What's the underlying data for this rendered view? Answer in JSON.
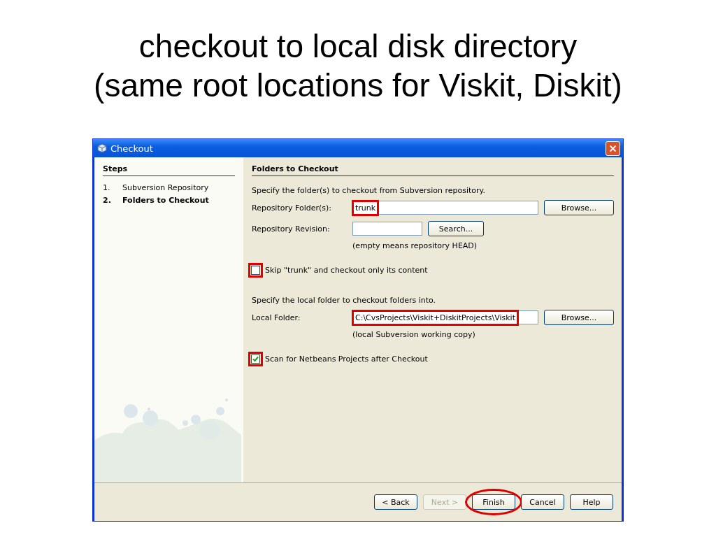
{
  "slide_title": [
    "checkout to local disk directory",
    "(same root locations for Viskit, Diskit)"
  ],
  "window": {
    "title": "Checkout"
  },
  "steps": {
    "heading": "Steps",
    "items": [
      {
        "number": "1.",
        "label": "Subversion Repository",
        "selected": false
      },
      {
        "number": "2.",
        "label": "Folders to Checkout",
        "selected": true
      }
    ]
  },
  "panel": {
    "heading": "Folders to Checkout",
    "rows": [
      {
        "kind": "text",
        "text": "Specify the folder(s) to checkout from Subversion repository."
      },
      {
        "kind": "field",
        "label": "Repository Folder(s):",
        "value": "trunk",
        "wide": true,
        "boxed": true,
        "button": "Browse..."
      },
      {
        "kind": "field",
        "label": "Repository Revision:",
        "value": "",
        "wide": false,
        "boxed": false,
        "button": "Search..."
      },
      {
        "kind": "hint",
        "text": "(empty means repository HEAD)"
      },
      {
        "kind": "checkbox",
        "label": "Skip \"trunk\" and checkout only its content",
        "checked": false,
        "boxed": true
      },
      {
        "kind": "text",
        "text": "Specify the local folder to checkout folders into."
      },
      {
        "kind": "field",
        "label": "Local Folder:",
        "value": "C:\\CvsProjects\\Viskit+DiskitProjects\\Viskit",
        "wide": true,
        "boxed": true,
        "button": "Browse..."
      },
      {
        "kind": "hint",
        "text": "(local Subversion working copy)"
      },
      {
        "kind": "checkbox",
        "label": "Scan for Netbeans Projects after Checkout",
        "checked": true,
        "boxed": true
      }
    ]
  },
  "buttons": [
    {
      "label": "< Back",
      "disabled": false,
      "circled": false
    },
    {
      "label": "Next >",
      "disabled": true,
      "circled": false
    },
    {
      "label": "Finish",
      "disabled": false,
      "circled": true
    },
    {
      "label": "Cancel",
      "disabled": false,
      "circled": false
    },
    {
      "label": "Help",
      "disabled": false,
      "circled": false
    }
  ]
}
